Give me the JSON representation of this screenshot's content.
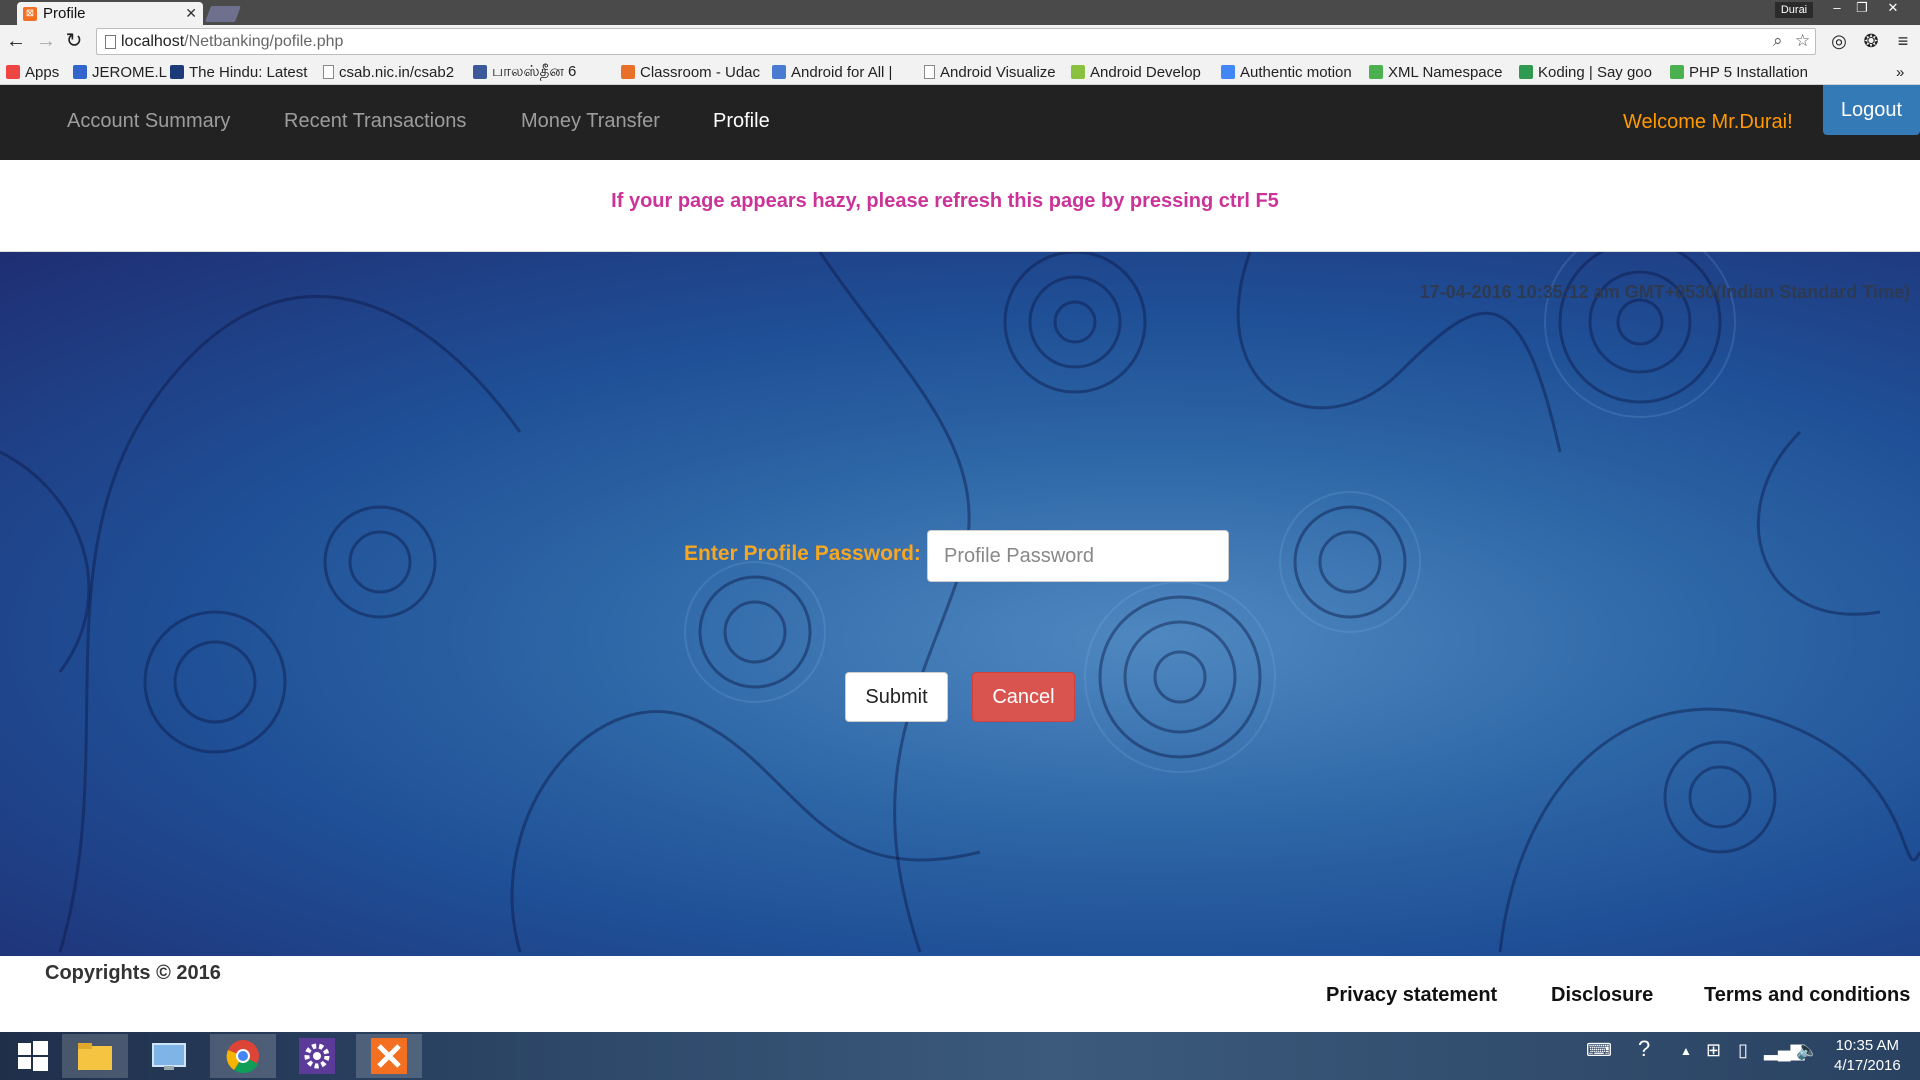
{
  "browser": {
    "tab_title": "Profile",
    "user_badge": "Durai",
    "url_host": "localhost",
    "url_path": "/Netbanking/pofile.php",
    "bookmarks": [
      {
        "label": "Apps",
        "icon": "apps-grid-icon",
        "color": "#e44"
      },
      {
        "label": "JEROME.L",
        "icon": "page-icon",
        "color": "#3366cc"
      },
      {
        "label": "The Hindu: Latest",
        "icon": "the-hindu-icon",
        "color": "#1a3a7a"
      },
      {
        "label": "csab.nic.in/csab2",
        "icon": "document-icon",
        "color": ""
      },
      {
        "label": "பாலஸ்தீன 6",
        "icon": "facebook-icon",
        "color": "#3b5998"
      },
      {
        "label": "Classroom - Udac",
        "icon": "udemy-icon",
        "color": "#e8702a"
      },
      {
        "label": "Android for All |",
        "icon": "android-for-all-icon",
        "color": "#4a7bd0"
      },
      {
        "label": "Android Visualize",
        "icon": "document-icon",
        "color": ""
      },
      {
        "label": "Android Develop",
        "icon": "android-icon",
        "color": "#8ac23f"
      },
      {
        "label": "Authentic motion",
        "icon": "google-icon",
        "color": "#4285f4"
      },
      {
        "label": "XML Namespace",
        "icon": "w3-icon",
        "color": "#4caf50"
      },
      {
        "label": "Koding | Say goo",
        "icon": "koding-icon",
        "color": "#2e9b4f"
      },
      {
        "label": "PHP 5 Installation",
        "icon": "w3schools-icon",
        "color": "#4caf50"
      }
    ]
  },
  "nav": {
    "links": [
      "Account Summary",
      "Recent Transactions",
      "Money Transfer",
      "Profile"
    ],
    "welcome": "Welcome Mr.Durai!",
    "logout": "Logout"
  },
  "notice": "If your page appears hazy, please refresh this page by pressing ctrl F5",
  "timestamp": "17-04-2016 10:35:12 am GMT+0530(Indian Standard Time)",
  "form": {
    "label": "Enter Profile Password:",
    "placeholder": "Profile Password",
    "submit": "Submit",
    "cancel": "Cancel"
  },
  "footer": {
    "copyright": "Copyrights © 2016",
    "links": [
      "Privacy statement",
      "Disclosure",
      "Terms and conditions"
    ]
  },
  "taskbar": {
    "time": "10:35 AM",
    "date": "4/17/2016"
  },
  "colors": {
    "nav_bg": "#222222",
    "welcome": "#ff9900",
    "logout_bg": "#337ab7",
    "notice": "#cc3399",
    "label": "#f5a623",
    "cancel_bg": "#d9534f"
  }
}
